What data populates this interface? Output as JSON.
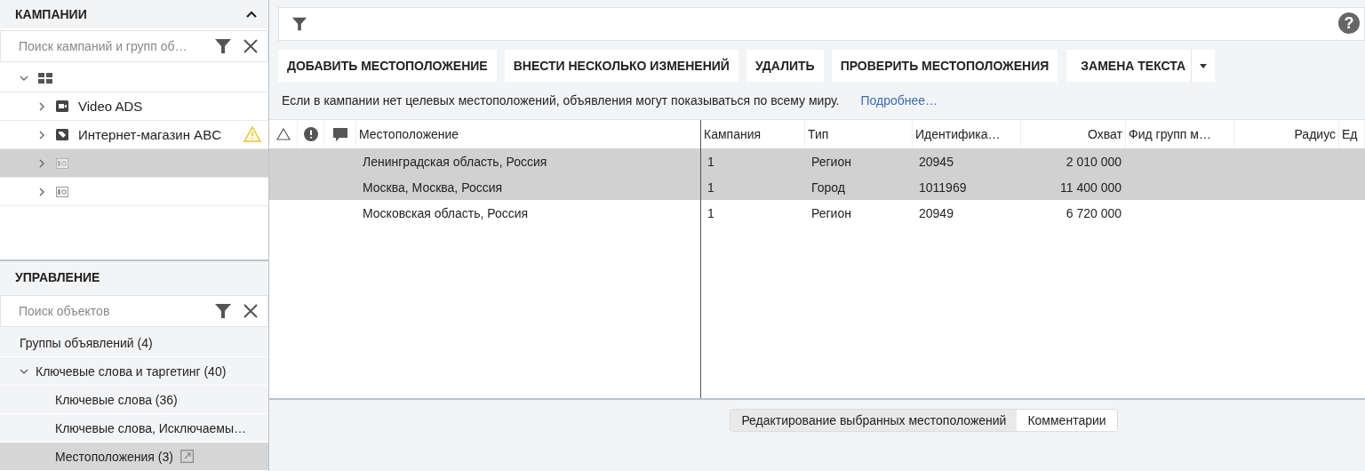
{
  "campaigns": {
    "title": "КАМПАНИИ",
    "search": {
      "placeholder": "Поиск кампаний и групп об…"
    },
    "tree": [
      {
        "kind": "account",
        "expanded": true,
        "selected": false,
        "warning": false,
        "children": [
          {
            "kind": "video",
            "label": "Video ADS",
            "expanded": false,
            "selected": false,
            "warning": false
          },
          {
            "kind": "shopping",
            "label": "Интернет-магазин ABC",
            "expanded": false,
            "selected": false,
            "warning": true
          },
          {
            "kind": "display",
            "expanded": false,
            "selected": true,
            "warning": false
          },
          {
            "kind": "display",
            "expanded": false,
            "selected": false,
            "warning": false
          }
        ]
      }
    ]
  },
  "management": {
    "title": "УПРАВЛЕНИЕ",
    "search": {
      "placeholder": "Поиск объектов"
    },
    "items": [
      {
        "label": "Группы объявлений (4)",
        "selected": false,
        "external": false
      },
      {
        "label": "Ключевые слова и таргетинг (40)",
        "selected": false,
        "external": false,
        "expanded": true,
        "children": [
          {
            "label": "Ключевые слова (36)",
            "selected": false,
            "external": false
          },
          {
            "label": "Ключевые слова, Исключаемы…",
            "selected": false,
            "external": false
          },
          {
            "label": "Местоположения (3)",
            "selected": true,
            "external": true
          }
        ]
      }
    ]
  },
  "help": "?",
  "toolbar": [
    {
      "label": "ДОБАВИТЬ МЕСТОПОЛОЖЕНИЕ",
      "kind": "plain"
    },
    {
      "label": "ВНЕСТИ НЕСКОЛЬКО ИЗМЕНЕНИЙ",
      "kind": "plain"
    },
    {
      "label": "УДАЛИТЬ",
      "kind": "plain"
    },
    {
      "label": "ПРОВЕРИТЬ МЕСТОПОЛОЖЕНИЯ",
      "kind": "plain"
    },
    {
      "label": "ЗАМЕНА ТЕКСТА",
      "kind": "split"
    }
  ],
  "notice": {
    "text": "Если в кампании нет целевых местоположений, объявления могут показываться по всему миру.",
    "link": "Подробнее…"
  },
  "table": {
    "columns": [
      "Местоположение",
      "Кампания",
      "Тип",
      "Идентифика…",
      "Охват",
      "Фид групп м…",
      "Радиус",
      "Ед"
    ],
    "rows": [
      {
        "selected": true,
        "cells": [
          "Ленинградская область, Россия",
          "1",
          "Регион",
          "20945",
          "2 010 000"
        ]
      },
      {
        "selected": true,
        "cells": [
          "Москва, Москва, Россия",
          "1",
          "Город",
          "1011969",
          "11 400 000"
        ]
      },
      {
        "selected": false,
        "cells": [
          "Московская область, Россия",
          "1",
          "Регион",
          "20949",
          "6 720 000"
        ]
      }
    ]
  },
  "bottom_tabs": [
    {
      "label": "Редактирование выбранных местоположений",
      "selected": true
    },
    {
      "label": "Комментарии",
      "selected": false
    }
  ]
}
